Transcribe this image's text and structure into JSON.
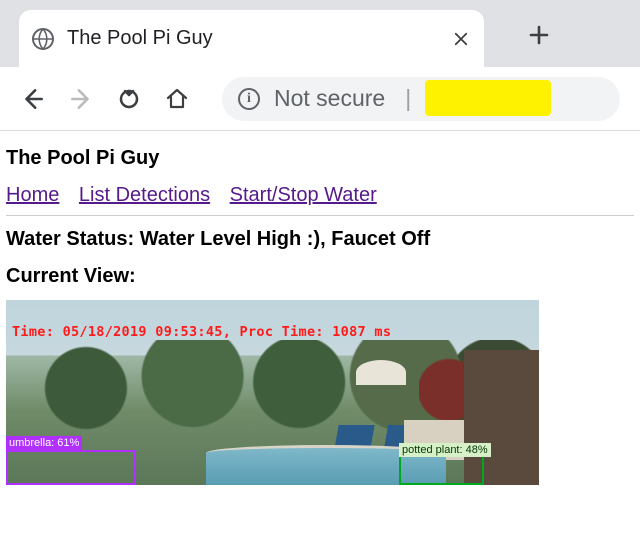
{
  "browser": {
    "tab_title": "The Pool Pi Guy",
    "address_label": "Not secure"
  },
  "page": {
    "site_title": "The Pool Pi Guy",
    "nav": {
      "home": "Home",
      "list_detections": "List Detections",
      "startstop": "Start/Stop Water"
    },
    "status_heading": "Water Status: Water Level High :), Faucet Off",
    "current_view_heading": "Current View:"
  },
  "camera": {
    "timestamp_overlay": "Time: 05/18/2019 09:53:45, Proc Time: 1087 ms",
    "detections": {
      "umbrella": "umbrella: 61%",
      "potted_plant": "potted plant: 48%"
    }
  }
}
